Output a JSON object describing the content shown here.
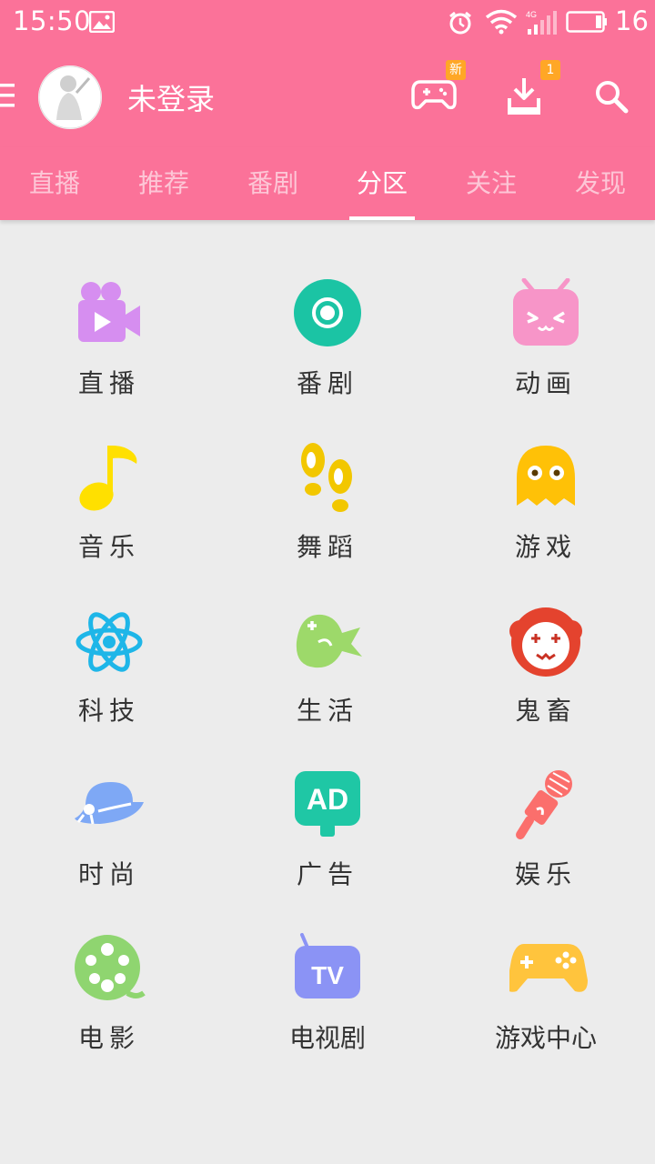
{
  "status_bar": {
    "time": "15:50",
    "battery_level": "16"
  },
  "app_bar": {
    "username": "未登录",
    "game_badge": "新",
    "download_badge": "1"
  },
  "tabs": [
    {
      "label": "直播"
    },
    {
      "label": "推荐"
    },
    {
      "label": "番剧"
    },
    {
      "label": "分区",
      "active": true
    },
    {
      "label": "关注"
    },
    {
      "label": "发现"
    }
  ],
  "categories": [
    {
      "label": "直播",
      "icon": "video-camera-icon",
      "color": "#d68ef0"
    },
    {
      "label": "番剧",
      "icon": "bangumi-disc-icon",
      "color": "#1bc4a4"
    },
    {
      "label": "动画",
      "icon": "tv-mascot-icon",
      "color": "#f795c8"
    },
    {
      "label": "音乐",
      "icon": "music-note-icon",
      "color": "#ffe000"
    },
    {
      "label": "舞蹈",
      "icon": "footprints-icon",
      "color": "#f2c700"
    },
    {
      "label": "游戏",
      "icon": "ghost-icon",
      "color": "#ffc107"
    },
    {
      "label": "科技",
      "icon": "atom-icon",
      "color": "#1eb6e8"
    },
    {
      "label": "生活",
      "icon": "fish-icon",
      "color": "#9dd96a"
    },
    {
      "label": "鬼畜",
      "icon": "clown-icon",
      "color": "#e4432e"
    },
    {
      "label": "时尚",
      "icon": "hat-icon",
      "color": "#7ea8f5"
    },
    {
      "label": "广告",
      "icon": "ad-bubble-icon",
      "color": "#1fc7a5"
    },
    {
      "label": "娱乐",
      "icon": "microphone-icon",
      "color": "#fb6f6c"
    },
    {
      "label": "电影",
      "icon": "film-reel-icon",
      "color": "#8fd570"
    },
    {
      "label": "电视剧",
      "icon": "tv-icon",
      "color": "#8b93f5"
    },
    {
      "label": "游戏中心",
      "icon": "gamepad-icon",
      "color": "#ffc43d"
    }
  ],
  "colors": {
    "brand_pink": "#fb7299",
    "background": "#ececec",
    "label_text": "#333333"
  }
}
